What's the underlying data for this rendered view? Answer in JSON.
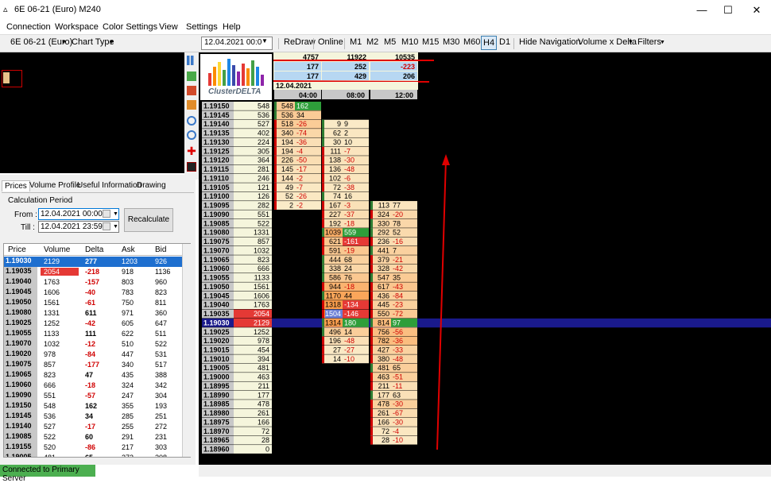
{
  "window": {
    "title": "6E 06-21 (Euro) M240",
    "minimize": "—",
    "maximize": "☐",
    "close": "✕"
  },
  "menu": [
    "Connection",
    "Workspace",
    "Color Settings",
    "View",
    "Settings",
    "Help"
  ],
  "toolbar": {
    "instrument": "6E 06-21 (Euro)",
    "chart_type": "Chart Type",
    "date": "12.04.2021 00:0",
    "redraw": "ReDraw",
    "online": "Online",
    "timeframes": [
      "M1",
      "M2",
      "M5",
      "M10",
      "M15",
      "M30",
      "M60",
      "H4",
      "D1"
    ],
    "active_timeframe": "H4",
    "hide_navigation": "Hide Navigation",
    "volume_delta": "Volume x Delta",
    "filters": "Filters"
  },
  "left_tabs": [
    "Prices",
    "Volume Profile",
    "Useful Information",
    "Drawing"
  ],
  "calc": {
    "title": "Calculation Period",
    "from_label": "From :",
    "from_value": "12.04.2021 00:00",
    "till_label": "Till :",
    "till_value": "12.04.2021 23:59",
    "recalculate": "Recalculate"
  },
  "price_table": {
    "headers": [
      "Price",
      "Volume",
      "Delta",
      "Ask",
      "Bid"
    ],
    "rows": [
      [
        "1.19030",
        "2129",
        "277",
        "1203",
        "926"
      ],
      [
        "1.19035",
        "2054",
        "-218",
        "918",
        "1136"
      ],
      [
        "1.19040",
        "1763",
        "-157",
        "803",
        "960"
      ],
      [
        "1.19045",
        "1606",
        "-40",
        "783",
        "823"
      ],
      [
        "1.19050",
        "1561",
        "-61",
        "750",
        "811"
      ],
      [
        "1.19080",
        "1331",
        "611",
        "971",
        "360"
      ],
      [
        "1.19025",
        "1252",
        "-42",
        "605",
        "647"
      ],
      [
        "1.19055",
        "1133",
        "111",
        "622",
        "511"
      ],
      [
        "1.19070",
        "1032",
        "-12",
        "510",
        "522"
      ],
      [
        "1.19020",
        "978",
        "-84",
        "447",
        "531"
      ],
      [
        "1.19075",
        "857",
        "-177",
        "340",
        "517"
      ],
      [
        "1.19065",
        "823",
        "47",
        "435",
        "388"
      ],
      [
        "1.19060",
        "666",
        "-18",
        "324",
        "342"
      ],
      [
        "1.19090",
        "551",
        "-57",
        "247",
        "304"
      ],
      [
        "1.19150",
        "548",
        "162",
        "355",
        "193"
      ],
      [
        "1.19145",
        "536",
        "34",
        "285",
        "251"
      ],
      [
        "1.19140",
        "527",
        "-17",
        "255",
        "272"
      ],
      [
        "1.19085",
        "522",
        "60",
        "291",
        "231"
      ],
      [
        "1.19155",
        "520",
        "-86",
        "217",
        "303"
      ],
      [
        "1.19005",
        "481",
        "65",
        "273",
        "208"
      ],
      [
        "1.19160",
        "478",
        "90",
        "284",
        "194"
      ]
    ]
  },
  "status": "Connected to Primary Server",
  "logo_text": "ClusterDELTA",
  "summary": {
    "row1": [
      "4757",
      "11922",
      "10535"
    ],
    "row2": [
      "177",
      "252",
      "-223"
    ],
    "row3": [
      "177",
      "429",
      "206"
    ]
  },
  "date_header": "12.04.2021",
  "time_headers": [
    "04:00",
    "08:00",
    "12:00"
  ],
  "ladder": [
    [
      "1.19150",
      "548"
    ],
    [
      "1.19145",
      "536"
    ],
    [
      "1.19140",
      "527"
    ],
    [
      "1.19135",
      "402"
    ],
    [
      "1.19130",
      "224"
    ],
    [
      "1.19125",
      "305"
    ],
    [
      "1.19120",
      "364"
    ],
    [
      "1.19115",
      "281"
    ],
    [
      "1.19110",
      "246"
    ],
    [
      "1.19105",
      "121"
    ],
    [
      "1.19100",
      "126"
    ],
    [
      "1.19095",
      "282"
    ],
    [
      "1.19090",
      "551"
    ],
    [
      "1.19085",
      "522"
    ],
    [
      "1.19080",
      "1331"
    ],
    [
      "1.19075",
      "857"
    ],
    [
      "1.19070",
      "1032"
    ],
    [
      "1.19065",
      "823"
    ],
    [
      "1.19060",
      "666"
    ],
    [
      "1.19055",
      "1133"
    ],
    [
      "1.19050",
      "1561"
    ],
    [
      "1.19045",
      "1606"
    ],
    [
      "1.19040",
      "1763"
    ],
    [
      "1.19035",
      "2054"
    ],
    [
      "1.19030",
      "2129"
    ],
    [
      "1.19025",
      "1252"
    ],
    [
      "1.19020",
      "978"
    ],
    [
      "1.19015",
      "454"
    ],
    [
      "1.19010",
      "394"
    ],
    [
      "1.19005",
      "481"
    ],
    [
      "1.19000",
      "463"
    ],
    [
      "1.18995",
      "211"
    ],
    [
      "1.18990",
      "177"
    ],
    [
      "1.18985",
      "478"
    ],
    [
      "1.18980",
      "261"
    ],
    [
      "1.18975",
      "166"
    ],
    [
      "1.18970",
      "72"
    ],
    [
      "1.18965",
      "28"
    ],
    [
      "1.18960",
      "0"
    ]
  ],
  "clusters": [
    {
      "start": 0,
      "cells": [
        [
          "548",
          "162"
        ],
        [
          "536",
          "34"
        ],
        [
          "518",
          "-26"
        ],
        [
          "340",
          "-74"
        ],
        [
          "194",
          "-36"
        ],
        [
          "194",
          "-4"
        ],
        [
          "226",
          "-50"
        ],
        [
          "145",
          "-17"
        ],
        [
          "144",
          "-2"
        ],
        [
          "49",
          "-7"
        ],
        [
          "52",
          "-26"
        ],
        [
          "2",
          "-2"
        ]
      ]
    },
    {
      "start": 2,
      "cells": [
        [
          "9",
          "9"
        ],
        [
          "62",
          "2"
        ],
        [
          "30",
          "10"
        ],
        [
          "111",
          "-7"
        ],
        [
          "138",
          "-30"
        ],
        [
          "136",
          "-48"
        ],
        [
          "102",
          "-6"
        ],
        [
          "72",
          "-38"
        ],
        [
          "74",
          "16"
        ],
        [
          "167",
          "-3"
        ],
        [
          "227",
          "-37"
        ],
        [
          "192",
          "-18"
        ],
        [
          "1039",
          "559"
        ],
        [
          "621",
          "-161"
        ],
        [
          "591",
          "-19"
        ],
        [
          "444",
          "68"
        ],
        [
          "338",
          "24"
        ],
        [
          "586",
          "76"
        ],
        [
          "944",
          "-18"
        ],
        [
          "1170",
          "44"
        ],
        [
          "1318",
          "-134"
        ],
        [
          "1504",
          "-146"
        ],
        [
          "1314",
          "180"
        ],
        [
          "496",
          "14"
        ],
        [
          "196",
          "-48"
        ],
        [
          "27",
          "-27"
        ],
        [
          "14",
          "-10"
        ]
      ]
    },
    {
      "start": 11,
      "cells": [
        [
          "113",
          "77"
        ],
        [
          "324",
          "-20"
        ],
        [
          "330",
          "78"
        ],
        [
          "292",
          "52"
        ],
        [
          "236",
          "-16"
        ],
        [
          "441",
          "7"
        ],
        [
          "379",
          "-21"
        ],
        [
          "328",
          "-42"
        ],
        [
          "547",
          "35"
        ],
        [
          "617",
          "-43"
        ],
        [
          "436",
          "-84"
        ],
        [
          "445",
          "-23"
        ],
        [
          "550",
          "-72"
        ],
        [
          "814",
          "97"
        ],
        [
          "756",
          "-56"
        ],
        [
          "782",
          "-36"
        ],
        [
          "427",
          "-33"
        ],
        [
          "380",
          "-48"
        ],
        [
          "481",
          "65"
        ],
        [
          "463",
          "-51"
        ],
        [
          "211",
          "-11"
        ],
        [
          "177",
          "63"
        ],
        [
          "478",
          "-30"
        ],
        [
          "261",
          "-67"
        ],
        [
          "166",
          "-30"
        ],
        [
          "72",
          "-4"
        ],
        [
          "28",
          "-10"
        ]
      ]
    }
  ],
  "colors": {
    "accent": "#3c7fb1",
    "status_green": "#4caf50",
    "current_price_band": "#1a1a8c",
    "annotation": "#e00000"
  }
}
